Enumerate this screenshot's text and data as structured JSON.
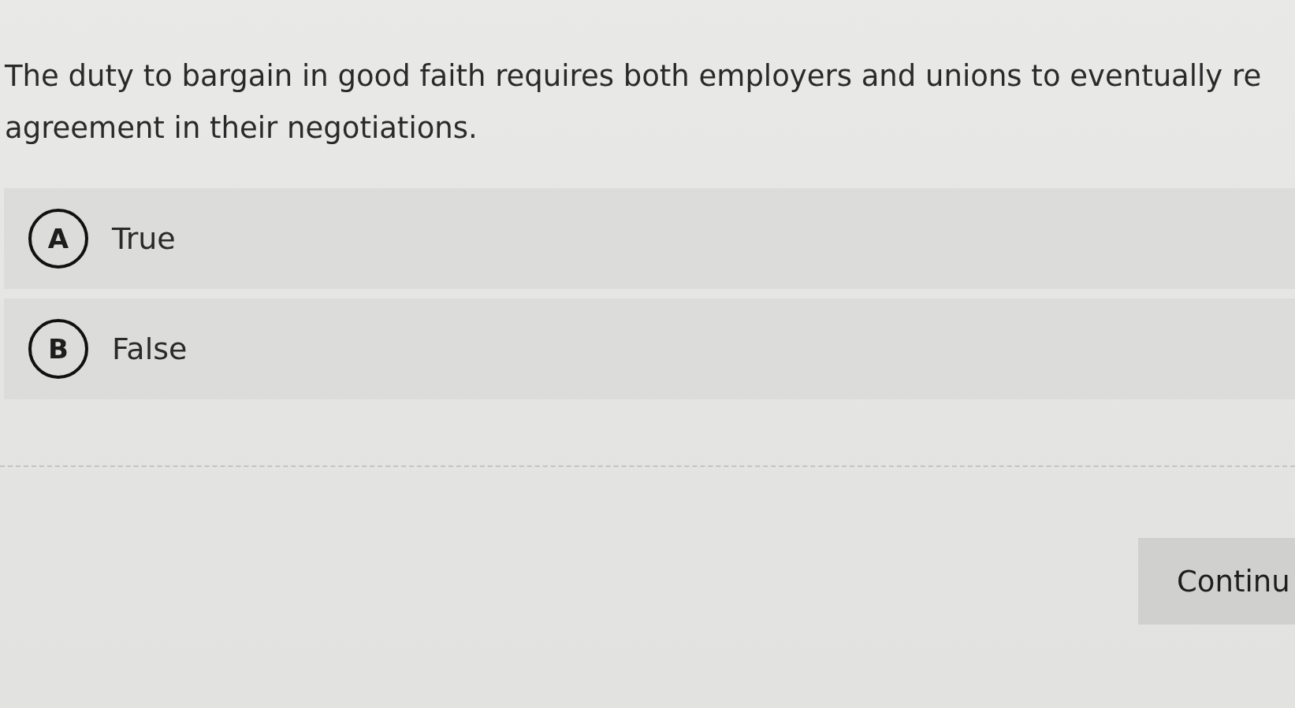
{
  "question": {
    "lines": [
      "The duty to bargain in good faith requires both employers and unions to eventually re",
      "agreement in their negotiations."
    ]
  },
  "options": [
    {
      "letter": "A",
      "label": "True",
      "selected": false
    },
    {
      "letter": "B",
      "label": "False",
      "selected": false
    }
  ],
  "continue_button": {
    "label": "Continu"
  }
}
